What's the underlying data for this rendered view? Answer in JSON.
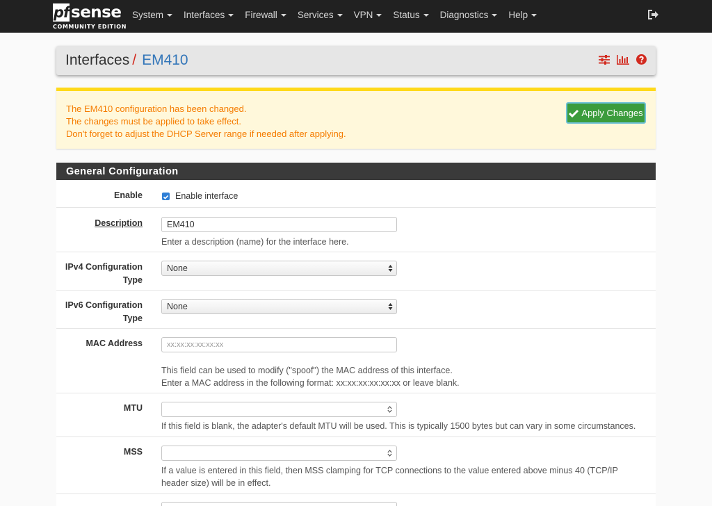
{
  "brand": {
    "pf": "pf",
    "sense": "sense",
    "edition": "COMMUNITY EDITION"
  },
  "nav": {
    "items": [
      {
        "label": "System"
      },
      {
        "label": "Interfaces"
      },
      {
        "label": "Firewall"
      },
      {
        "label": "Services"
      },
      {
        "label": "VPN"
      },
      {
        "label": "Status"
      },
      {
        "label": "Diagnostics"
      },
      {
        "label": "Help"
      }
    ],
    "logout_icon": "sign-out-icon"
  },
  "header": {
    "breadcrumb_parent": "Interfaces",
    "breadcrumb_sep": "/",
    "breadcrumb_current": "EM410",
    "icons": [
      "sliders-icon",
      "bar-chart-icon",
      "question-circle-icon"
    ]
  },
  "alert": {
    "line1": "The EM410 configuration has been changed.",
    "line2": "The changes must be applied to take effect.",
    "line3": "Don't forget to adjust the DHCP Server range if needed after applying.",
    "apply_label": "Apply Changes"
  },
  "general": {
    "title": "General Configuration",
    "enable": {
      "label": "Enable",
      "checkbox_label": "Enable interface",
      "checked": true
    },
    "description": {
      "label": "Description",
      "value": "EM410",
      "help": "Enter a description (name) for the interface here."
    },
    "ipv4": {
      "label_line1": "IPv4 Configuration",
      "label_line2": "Type",
      "value": "None"
    },
    "ipv6": {
      "label_line1": "IPv6 Configuration",
      "label_line2": "Type",
      "value": "None"
    },
    "mac": {
      "label": "MAC Address",
      "placeholder": "xx:xx:xx:xx:xx:xx",
      "help1": "This field can be used to modify (\"spoof\") the MAC address of this interface.",
      "help2": "Enter a MAC address in the following format: xx:xx:xx:xx:xx:xx or leave blank."
    },
    "mtu": {
      "label": "MTU",
      "value": "",
      "help": "If this field is blank, the adapter's default MTU will be used. This is typically 1500 bytes but can vary in some circumstances."
    },
    "mss": {
      "label": "MSS",
      "value": "",
      "help1": "If a value is entered in this field, then MSS clamping for TCP connections to the value entered above minus 40 (TCP/IP",
      "help2": "header size) will be in effect."
    }
  },
  "colors": {
    "navbar": "#212121",
    "accent_red": "#d22b20",
    "link_blue": "#3376b9",
    "alert_text": "#f57c00",
    "alert_border": "#ffd91a",
    "apply_green": "#3b9c3c"
  }
}
